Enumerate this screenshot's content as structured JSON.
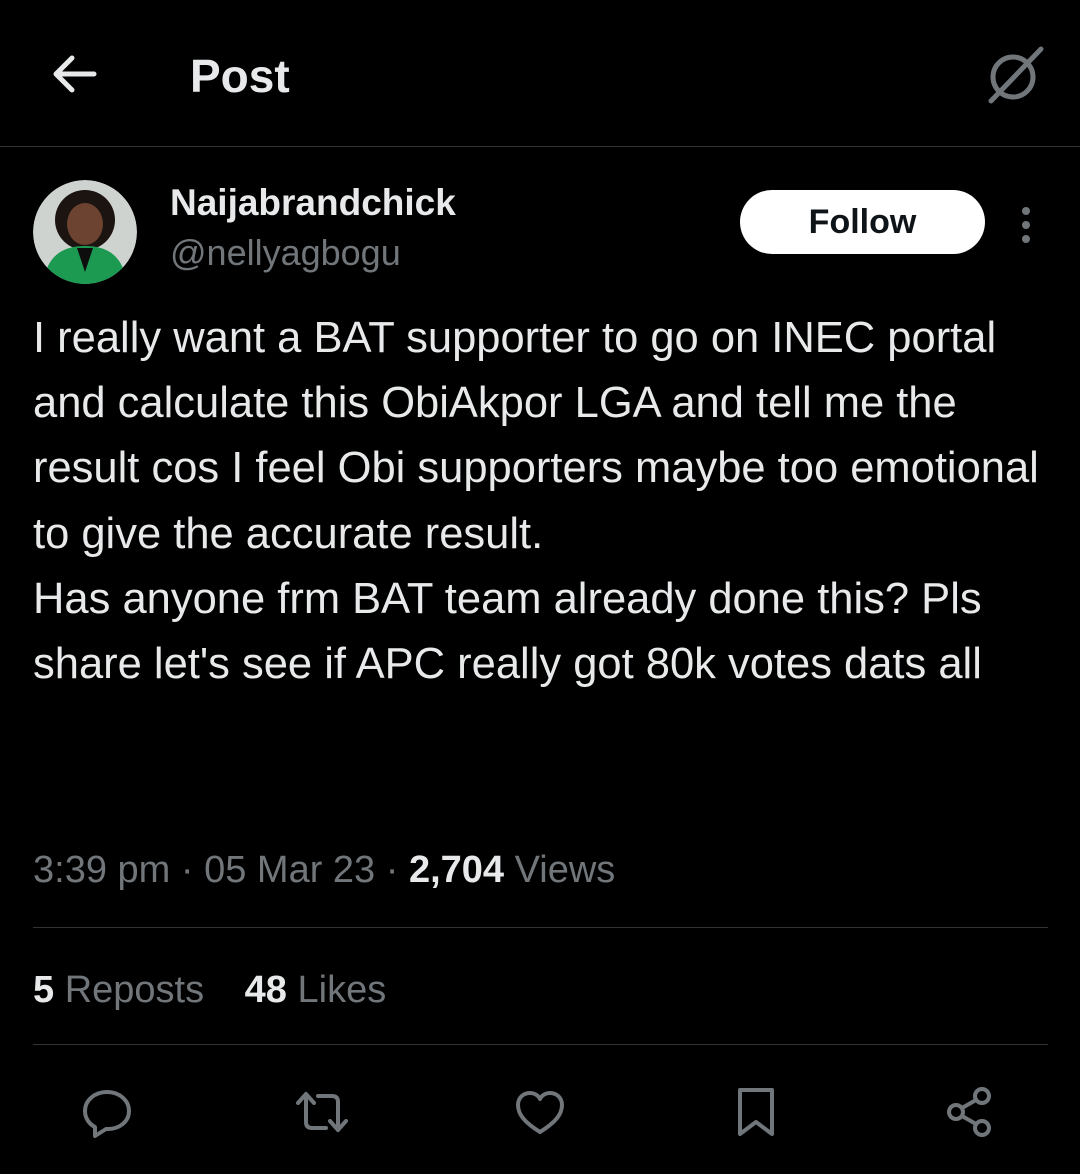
{
  "header": {
    "title": "Post",
    "back_icon": "arrow-left-icon",
    "action_icon": "grok-icon"
  },
  "author": {
    "display_name": "Naijabrandchick",
    "handle": "@nellyagbogu",
    "avatar_icon": "profile-photo"
  },
  "follow_label": "Follow",
  "more_icon": "more-vertical-icon",
  "tweet": {
    "text": "I really want a BAT supporter to go on INEC portal and calculate this ObiAkpor LGA and tell me the result cos I feel Obi supporters maybe too emotional to give the accurate result.\nHas anyone frm BAT team already done this? Pls share let's see if APC really got 80k votes dats all"
  },
  "meta": {
    "time": "3:39 pm",
    "separator": "·",
    "date": "05 Mar 23",
    "views_count": "2,704",
    "views_label": "Views"
  },
  "stats": {
    "reposts_count": "5",
    "reposts_label": "Reposts",
    "likes_count": "48",
    "likes_label": "Likes"
  },
  "actions": [
    "reply-icon",
    "repost-icon",
    "like-icon",
    "bookmark-icon",
    "share-icon"
  ],
  "colors": {
    "background": "#000000",
    "primary_text": "#e7e9ea",
    "secondary_text": "#71767b",
    "divider": "#2f3336",
    "follow_button_bg": "#ffffff",
    "follow_button_text": "#0f1419"
  }
}
